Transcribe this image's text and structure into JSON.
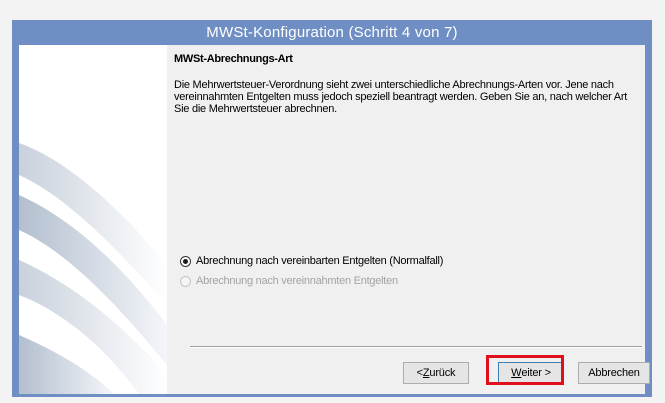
{
  "window": {
    "title": "MWSt-Konfiguration (Schritt 4 von 7)"
  },
  "content": {
    "heading": "MWSt-Abrechnungs-Art",
    "description": "Die Mehrwertsteuer-Verordnung sieht zwei unterschiedliche Abrechnungs-Arten vor. Jene nach vereinnahmten Entgelten muss jedoch speziell beantragt werden. Geben Sie an, nach welcher Art Sie die Mehrwertsteuer abrechnen."
  },
  "options": [
    {
      "label": "Abrechnung nach vereinbarten Entgelten (Normalfall)",
      "selected": true,
      "enabled": true
    },
    {
      "label": "Abrechnung nach vereinnahmten Entgelten",
      "selected": false,
      "enabled": false
    }
  ],
  "buttons": {
    "back_prefix": "< ",
    "back_mnemonic": "Z",
    "back_rest": "urück",
    "next_mnemonic": "W",
    "next_rest": "eiter >",
    "cancel_label": "Abbrechen"
  },
  "colors": {
    "title_bar": "#6f8fc4",
    "highlight": "#e0101a"
  }
}
